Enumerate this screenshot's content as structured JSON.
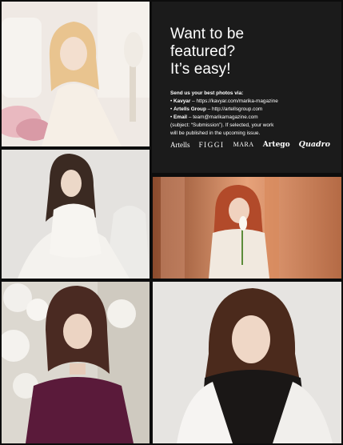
{
  "headline": {
    "line1": "Want to be",
    "line2": "featured?",
    "line3": "It’s easy!"
  },
  "submission": {
    "intro": "Send us your best photos via:",
    "kavyar_label": "Kavyar",
    "kavyar_text": " – https://kavyar.com/marika-magazine",
    "artells_label": "Artells Group",
    "artells_text": " – http://artellsgroup.com",
    "email_label": "Email",
    "email_text": " – team@marikamagazine.com",
    "note_line1": "(subject: “Submission”). If selected, your work",
    "note_line2": "will be published in the upcoming issue."
  },
  "bullet": "•",
  "logos": [
    "Artells",
    "FIGGI",
    "MARA",
    "Artego",
    "Quadro"
  ],
  "photos": [
    {
      "name": "photo-blonde-woman-white-room",
      "palette": [
        "#efe9e4",
        "#f6efe6",
        "#e9c48f",
        "#f3dfcf"
      ]
    },
    {
      "name": "photo-woman-white-dress-armchair",
      "palette": [
        "#e4e2df",
        "#f4f2ee",
        "#3b2a22",
        "#f0ece6"
      ]
    },
    {
      "name": "photo-redhead-with-calla-lily",
      "palette": [
        "#b46a45",
        "#e7a27a",
        "#b24a2a",
        "#f1e9df"
      ]
    },
    {
      "name": "photo-woman-purple-top-orchids",
      "palette": [
        "#dcd8d0",
        "#f2f0ec",
        "#4a2a22",
        "#5a1a3a"
      ]
    },
    {
      "name": "photo-brunette-white-coat",
      "palette": [
        "#e6e4e1",
        "#f1efec",
        "#4b2a1c",
        "#f6f4f2"
      ]
    }
  ]
}
